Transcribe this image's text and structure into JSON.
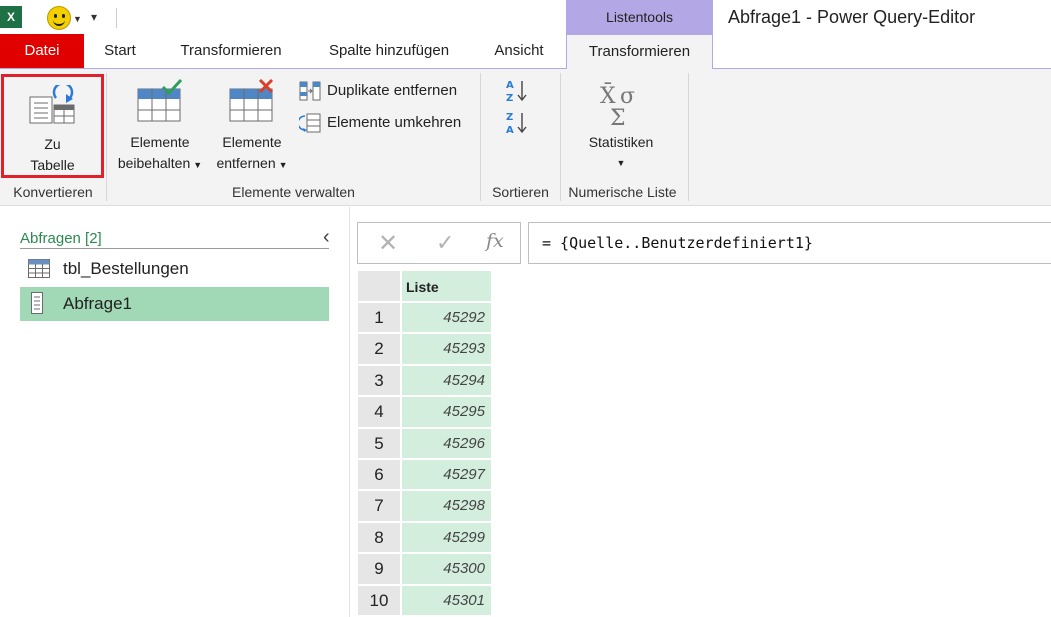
{
  "window": {
    "title": "Abfrage1 - Power Query-Editor",
    "app_icon": "excel-icon",
    "context_tab_group": "Listentools"
  },
  "quick_access": {
    "icons": [
      "smiley-icon",
      "dropdown-arrow-icon",
      "customize-qat-icon"
    ]
  },
  "ribbon_tabs": [
    {
      "label": "Datei"
    },
    {
      "label": "Start"
    },
    {
      "label": "Transformieren"
    },
    {
      "label": "Spalte hinzufügen"
    },
    {
      "label": "Ansicht"
    },
    {
      "label": "Transformieren",
      "active": true
    }
  ],
  "ribbon": {
    "groups": {
      "konvertieren": {
        "label": "Konvertieren",
        "zu_tabelle": {
          "line1": "Zu",
          "line2": "Tabelle",
          "highlighted": true
        }
      },
      "elemente_verwalten": {
        "label": "Elemente verwalten",
        "beibehalten": {
          "line1": "Elemente",
          "line2": "beibehalten"
        },
        "entfernen": {
          "line1": "Elemente",
          "line2": "entfernen"
        },
        "duplikate": "Duplikate entfernen",
        "umkehren": "Elemente umkehren"
      },
      "sortieren": {
        "label": "Sortieren",
        "icons": [
          "sort-ascending-icon",
          "sort-descending-icon"
        ]
      },
      "numerische_liste": {
        "label": "Numerische Liste",
        "statistiken": "Statistiken"
      }
    }
  },
  "queries_pane": {
    "header": "Abfragen [2]",
    "items": [
      {
        "label": "tbl_Bestellungen",
        "icon": "table-icon",
        "selected": false
      },
      {
        "label": "Abfrage1",
        "icon": "list-icon",
        "selected": true
      }
    ]
  },
  "formula_bar": {
    "formula": "= {Quelle..Benutzerdefiniert1}",
    "fx_label": "fx"
  },
  "grid": {
    "column_header": "Liste",
    "rows": [
      {
        "n": "1",
        "value": "45292"
      },
      {
        "n": "2",
        "value": "45293"
      },
      {
        "n": "3",
        "value": "45294"
      },
      {
        "n": "4",
        "value": "45295"
      },
      {
        "n": "5",
        "value": "45296"
      },
      {
        "n": "6",
        "value": "45297"
      },
      {
        "n": "7",
        "value": "45298"
      },
      {
        "n": "8",
        "value": "45299"
      },
      {
        "n": "9",
        "value": "45300"
      },
      {
        "n": "10",
        "value": "45301"
      }
    ]
  },
  "colors": {
    "datei_tab": "#e00000",
    "context_tab": "#b4a7e6",
    "selected_query": "#a1d8b6",
    "grid_cell": "#d4eedd",
    "highlight_border": "#e0202a"
  }
}
